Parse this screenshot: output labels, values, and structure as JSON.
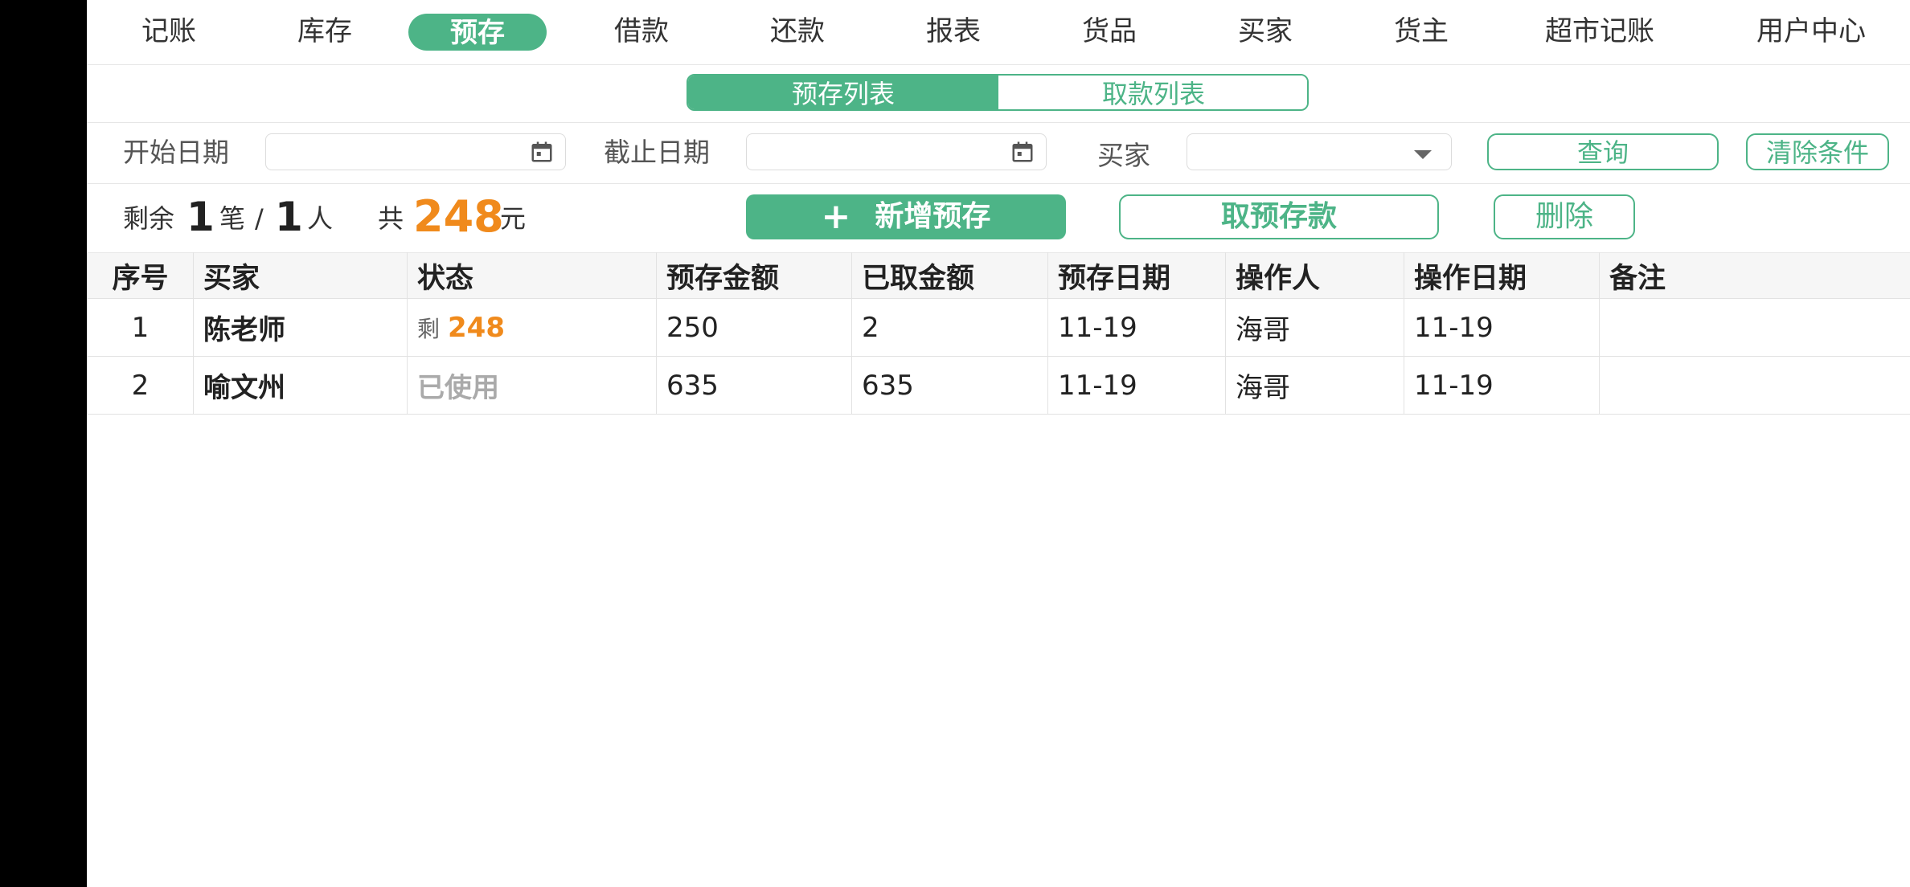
{
  "nav": {
    "items": [
      "记账",
      "库存",
      "预存",
      "借款",
      "还款",
      "报表",
      "货品",
      "买家",
      "货主",
      "超市记账",
      "用户中心"
    ],
    "active": "预存"
  },
  "subtabs": {
    "active": "预存列表",
    "inactive": "取款列表"
  },
  "filters": {
    "start_date_label": "开始日期",
    "start_date_value": "",
    "end_date_label": "截止日期",
    "end_date_value": "",
    "buyer_label": "买家",
    "buyer_value": "",
    "query_button": "查询",
    "clear_button": "清除条件"
  },
  "summary": {
    "remain_prefix": "剩余",
    "count": "1",
    "count_unit": "笔",
    "separator": "/",
    "people": "1",
    "people_unit": "人",
    "total_prefix": "共",
    "total": "248",
    "total_unit": "元"
  },
  "actions": {
    "add_label": "新增预存",
    "withdraw_label": "取预存款",
    "delete_label": "删除"
  },
  "table": {
    "headers": [
      "序号",
      "买家",
      "状态",
      "预存金额",
      "已取金额",
      "预存日期",
      "操作人",
      "操作日期",
      "备注"
    ],
    "rows": [
      {
        "no": "1",
        "buyer": "陈老师",
        "status_label": "剩",
        "status_value": "248",
        "deposit": "250",
        "withdrawn": "2",
        "deposit_date": "11-19",
        "operator": "海哥",
        "op_date": "11-19",
        "note": ""
      },
      {
        "no": "2",
        "buyer": "喻文州",
        "status_text": "已使用",
        "deposit": "635",
        "withdrawn": "635",
        "deposit_date": "11-19",
        "operator": "海哥",
        "op_date": "11-19",
        "note": ""
      }
    ]
  },
  "colors": {
    "accent": "#4db487",
    "highlight": "#f08a1c"
  }
}
